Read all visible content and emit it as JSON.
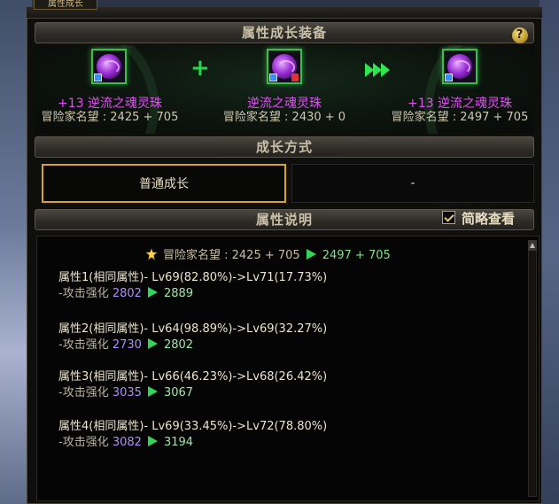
{
  "window": {
    "tab_label": "属性成长",
    "header_title": "属性成长装备",
    "help_label": "?"
  },
  "equipment": {
    "plus_symbol": "+",
    "left": {
      "enhance": "+13",
      "name": "逆流之魂灵珠",
      "fame": "冒险家名望 : 2425 + 705"
    },
    "middle": {
      "enhance": "",
      "name": "逆流之魂灵珠",
      "fame": "冒险家名望 : 2430 + 0"
    },
    "right": {
      "enhance": "+13",
      "name": "逆流之魂灵珠",
      "fame": "冒险家名望 : 2497 + 705"
    }
  },
  "growth": {
    "header_title": "成长方式",
    "options": [
      "普通成长",
      "-"
    ],
    "selected": "普通成长"
  },
  "description": {
    "header_title": "属性说明",
    "simple_view_label": "简略查看",
    "simple_view_checked": true,
    "summary": {
      "label": "冒险家名望 : 2425 + 705",
      "after": "2497 + 705"
    },
    "attributes": [
      {
        "title": "属性1(相同属性)- Lv69(82.80%)->Lv71(17.73%)",
        "sub_label": "-攻击强化",
        "old": "2802",
        "new": "2889"
      },
      {
        "title": "属性2(相同属性)- Lv64(98.89%)->Lv69(32.27%)",
        "sub_label": "-攻击强化",
        "old": "2730",
        "new": "2802"
      },
      {
        "title": "属性3(相同属性)- Lv66(46.23%)->Lv68(26.42%)",
        "sub_label": "-攻击强化",
        "old": "3035",
        "new": "3067"
      },
      {
        "title": "属性4(相同属性)- Lv69(33.45%)->Lv72(78.80%)",
        "sub_label": "-攻击强化",
        "old": "3082",
        "new": "3194"
      }
    ]
  },
  "colors": {
    "accent_gold": "#d9a425",
    "item_name": "#e04ef5",
    "green": "#2fe650",
    "old_value": "#b08cff"
  }
}
